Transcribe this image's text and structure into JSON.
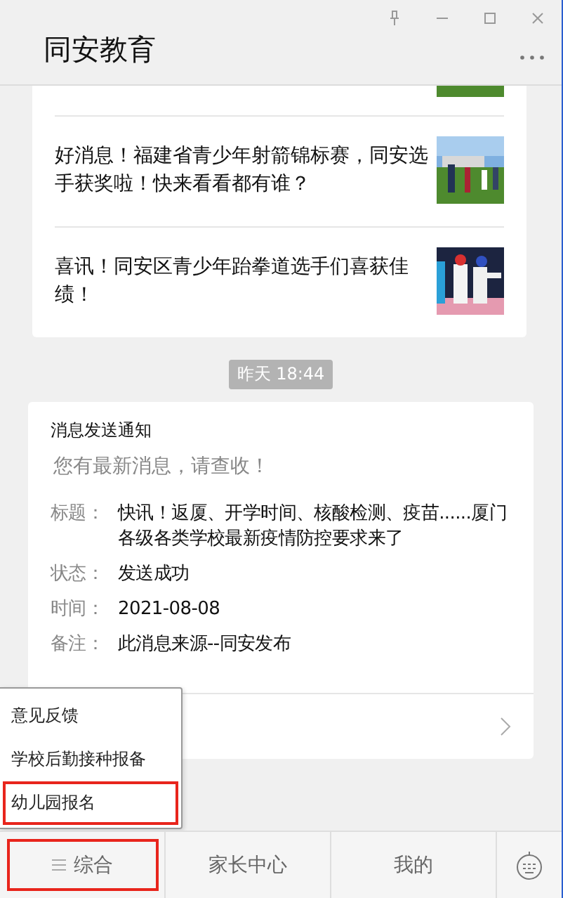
{
  "window": {
    "title": "同安教育"
  },
  "articles": [
    {
      "title": "好消息！福建省青少年射箭锦标赛，同安选手获奖啦！快来看看都有谁？",
      "kind": "field"
    },
    {
      "title": "喜讯！同安区青少年跆拳道选手们喜获佳绩！",
      "kind": "arena"
    }
  ],
  "timestamp": "昨天 18:44",
  "notice": {
    "heading": "消息发送通知",
    "subtitle": "您有最新消息，请查收！",
    "fields": [
      {
        "label": "标题：",
        "value": "快讯！返厦、开学时间、核酸检测、疫苗......厦门各级各类学校最新疫情防控要求来了"
      },
      {
        "label": "状态：",
        "value": "发送成功"
      },
      {
        "label": "时间：",
        "value": "2021-08-08"
      },
      {
        "label": "备注：",
        "value": "此消息来源--同安发布"
      }
    ]
  },
  "menu": {
    "items": [
      {
        "label": "意见反馈",
        "highlighted": false
      },
      {
        "label": "学校后勤接种报备",
        "highlighted": false
      },
      {
        "label": "幼儿园报名",
        "highlighted": true
      }
    ]
  },
  "bottom_tabs": [
    {
      "label": "综合",
      "kind": "menu",
      "highlighted": true
    },
    {
      "label": "家长中心",
      "kind": "plain",
      "highlighted": false
    },
    {
      "label": "我的",
      "kind": "plain",
      "highlighted": false
    }
  ]
}
